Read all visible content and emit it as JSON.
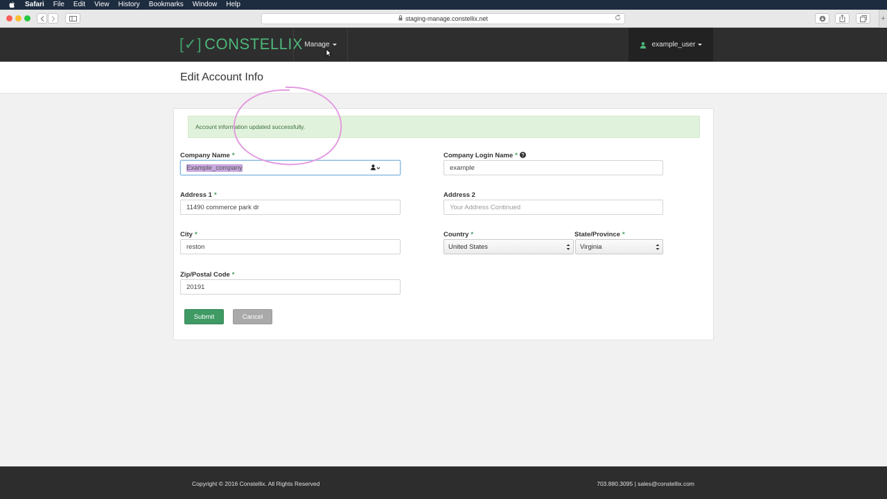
{
  "menubar": {
    "items": [
      "Safari",
      "File",
      "Edit",
      "View",
      "History",
      "Bookmarks",
      "Window",
      "Help"
    ]
  },
  "browser": {
    "url": "staging-manage.constellix.net",
    "new_tab_glyph": "+"
  },
  "header": {
    "logo_bracket": "[✓]",
    "logo_text": "CONSTELLIX",
    "nav_manage": "Manage",
    "user_name": "example_user"
  },
  "page": {
    "title": "Edit Account Info"
  },
  "alert": {
    "message": "Account information updated successfully."
  },
  "form": {
    "required_mark": "*",
    "company_name": {
      "label": "Company Name",
      "value": "Example_company"
    },
    "company_login": {
      "label": "Company Login Name",
      "value": "example"
    },
    "address1": {
      "label": "Address 1",
      "value": "11490 commerce park dr"
    },
    "address2": {
      "label": "Address 2",
      "placeholder": "Your Address Continued"
    },
    "city": {
      "label": "City",
      "value": "reston"
    },
    "country": {
      "label": "Country",
      "value": "United States"
    },
    "state": {
      "label": "State/Province",
      "value": "Virginia"
    },
    "zip": {
      "label": "Zip/Postal Code",
      "value": "20191"
    },
    "submit_label": "Submit",
    "cancel_label": "Cancel"
  },
  "footer": {
    "copyright": "Copyright © 2016 Constellix. All Rights Reserved",
    "contact": "703.880.3095 | sales@constellix.com"
  },
  "colors": {
    "brand_green": "#4db67a",
    "header_bg": "#2e2e2e",
    "alert_bg": "#e1f2dc",
    "annotation": "#e39be0"
  }
}
